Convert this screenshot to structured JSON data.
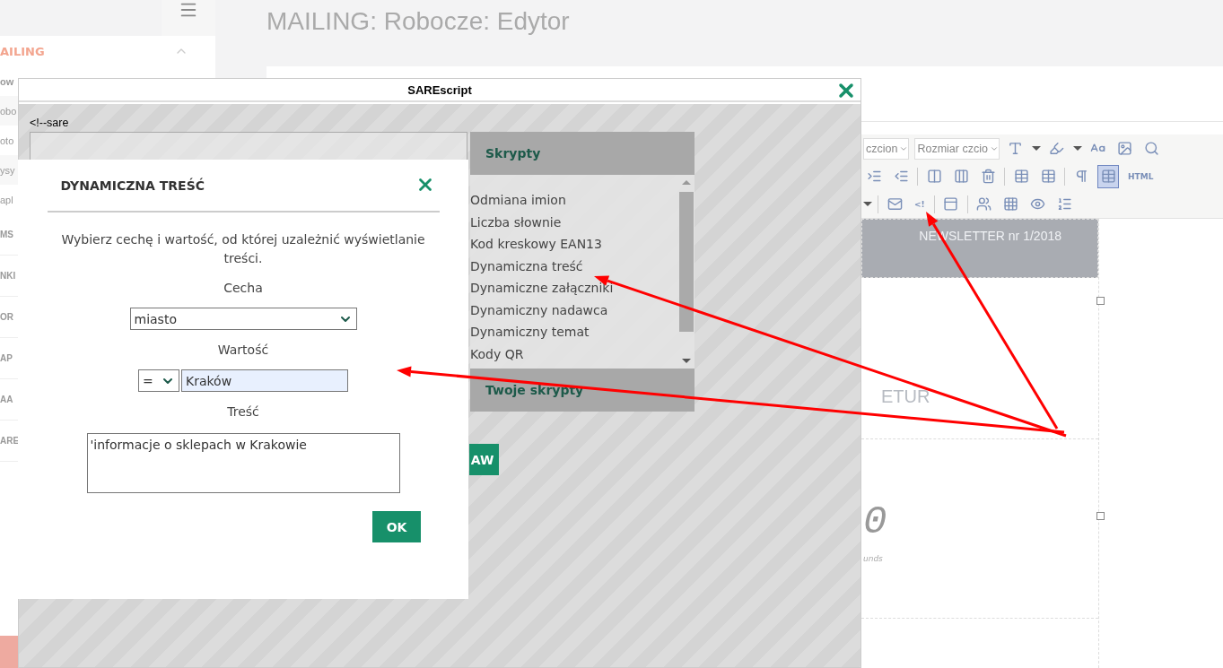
{
  "page": {
    "title": "MAILING: Robocze: Edytor"
  },
  "sidebar": {
    "section": "AILING",
    "items": [
      "ow",
      "obo",
      "oto",
      "ysy",
      "apl"
    ],
    "groups": [
      "MS",
      "NKI",
      "OR",
      "AP",
      "AA",
      "ARE"
    ]
  },
  "editor": {
    "toolbar": [
      [
        {
          "kind": "dropdown",
          "label": "czcion"
        },
        {
          "kind": "dropdown",
          "label": "Rozmiar czcio"
        },
        {
          "kind": "font-color",
          "active": false
        },
        {
          "kind": "caret"
        },
        {
          "kind": "highlight",
          "active": false
        },
        {
          "kind": "caret"
        },
        {
          "kind": "styles",
          "active": false
        },
        {
          "kind": "image",
          "active": false
        },
        {
          "kind": "preview",
          "active": false
        }
      ],
      [
        {
          "kind": "indent",
          "active": false
        },
        {
          "kind": "outdent",
          "active": false
        },
        {
          "kind": "sep"
        },
        {
          "kind": "col-left",
          "active": false
        },
        {
          "kind": "col-right",
          "active": false
        },
        {
          "kind": "col-delete",
          "active": false
        },
        {
          "kind": "sep"
        },
        {
          "kind": "table",
          "active": false
        },
        {
          "kind": "table-props",
          "active": false
        },
        {
          "kind": "sep"
        },
        {
          "kind": "pilcrow",
          "active": false
        },
        {
          "kind": "table",
          "active": true
        },
        {
          "kind": "text",
          "label": "HTML",
          "active": false
        }
      ],
      [
        {
          "kind": "caret"
        },
        {
          "kind": "sep"
        },
        {
          "kind": "mail",
          "active": false
        },
        {
          "kind": "text",
          "label": "<!",
          "active": false
        },
        {
          "kind": "sep"
        },
        {
          "kind": "frame",
          "active": false
        },
        {
          "kind": "sep"
        },
        {
          "kind": "people",
          "active": false
        },
        {
          "kind": "grid",
          "active": false
        },
        {
          "kind": "eye",
          "active": false
        },
        {
          "kind": "numbers",
          "active": false
        }
      ]
    ],
    "banner": "NEWSLETTER nr 1/2018",
    "heading": "ETUR",
    "counter": "0",
    "counter_caption": "unds"
  },
  "sarescript": {
    "title": "SAREscript",
    "code_prefix": "<!--sare",
    "scripts_header": "Skrypty",
    "scripts": [
      "Odmiana imion",
      "Liczba słownie",
      "Kod kreskowy EAN13",
      "Dynamiczna treść",
      "Dynamiczne załączniki",
      "Dynamiczny nadawca",
      "Dynamiczny temat",
      "Kody QR"
    ],
    "own_scripts_header": "Twoje skrypty",
    "button": "AW"
  },
  "dialog": {
    "title": "DYNAMICZNA TREŚĆ",
    "intro": "Wybierz cechę i wartość, od której uzależnić wyświetlanie treści.",
    "feature_label": "Cecha",
    "feature": "miasto",
    "value_label": "Wartość",
    "operator": "=",
    "value": "Kraków",
    "content_label": "Treść",
    "content": "'informacje o sklepach w Krakowie",
    "ok": "OK"
  },
  "annotations": [
    {
      "kind": "arrow"
    },
    {
      "kind": "arrow"
    },
    {
      "kind": "arrow"
    }
  ]
}
